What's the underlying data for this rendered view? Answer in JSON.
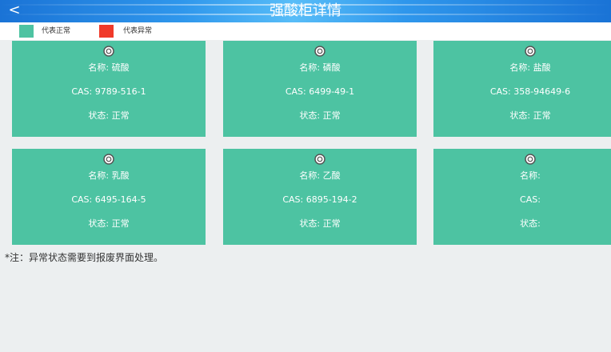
{
  "header": {
    "title": "强酸柜详情",
    "back_glyph": "<"
  },
  "legend": [
    {
      "label": "代表正常",
      "color": "#4dc3a2"
    },
    {
      "label": "代表异常",
      "color": "#f03a2a"
    }
  ],
  "cards": [
    {
      "name": "名称: 硫酸",
      "cas": "CAS:    9789-516-1",
      "status": "状态:    正常"
    },
    {
      "name": "名称: 磷酸",
      "cas": "CAS:    6499-49-1",
      "status": "状态:    正常"
    },
    {
      "name": "名称: 盐酸",
      "cas": "CAS:    358-94649-6",
      "status": "状态:    正常"
    },
    {
      "name": "名称: 乳酸",
      "cas": "CAS:    6495-164-5",
      "status": "状态:    正常"
    },
    {
      "name": "名称: 乙酸",
      "cas": "CAS:    6895-194-2",
      "status": "状态:    正常"
    },
    {
      "name": "名称:",
      "cas": "CAS:",
      "status": "状态:"
    }
  ],
  "note": "*注：异常状态需要到报废界面处理。",
  "colors": {
    "card": "#4dc3a2",
    "abnormal": "#f03a2a",
    "header": "#2f97ec"
  }
}
